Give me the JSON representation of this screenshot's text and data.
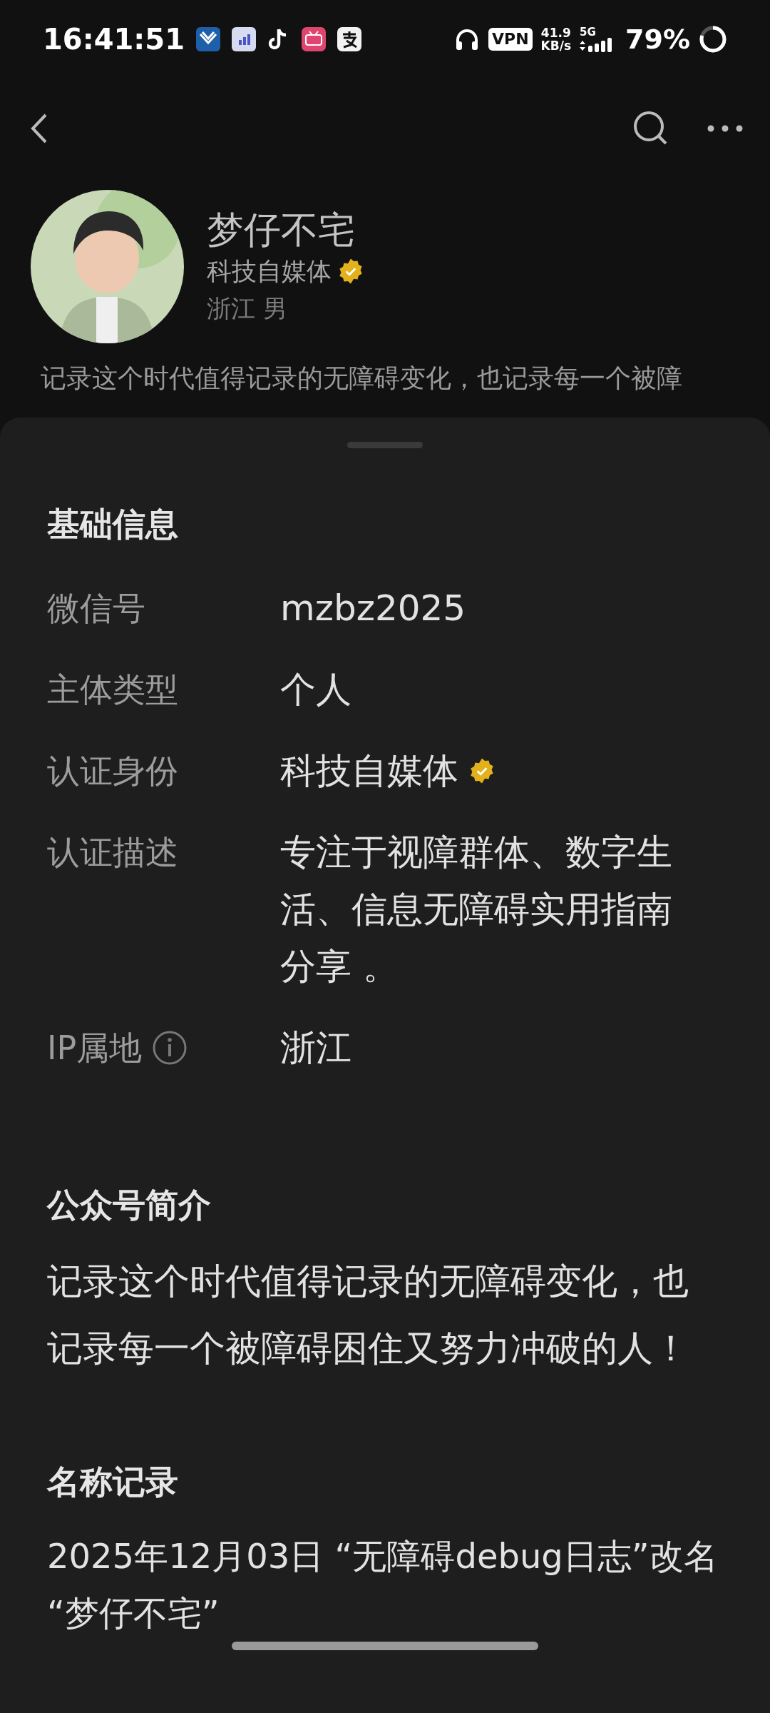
{
  "status_bar": {
    "time": "16:41:51",
    "vpn": "VPN",
    "speed": "41.9",
    "speed_unit": "KB/s",
    "network": "5G",
    "battery": "79%"
  },
  "profile": {
    "name": "梦仔不宅",
    "verification": "科技自媒体",
    "verified": true,
    "location_gender": "浙江 男",
    "bio": "记录这个时代值得记录的无障碍变化，也记录每一个被障"
  },
  "basic_info": {
    "title": "基础信息",
    "rows": [
      {
        "label": "微信号",
        "value": "mzbz2025",
        "verified": false,
        "info": false
      },
      {
        "label": "主体类型",
        "value": "个人",
        "verified": false,
        "info": false
      },
      {
        "label": "认证身份",
        "value": "科技自媒体",
        "verified": true,
        "info": false
      },
      {
        "label": "认证描述",
        "value": "专注于视障群体、数字生活、信息无障碍实用指南分享 。",
        "verified": false,
        "info": false
      },
      {
        "label": "IP属地",
        "value": "浙江",
        "verified": false,
        "info": true
      }
    ]
  },
  "intro": {
    "title": "公众号简介",
    "text": "记录这个时代值得记录的无障碍变化，也记录每一个被障碍困住又努力冲破的人！"
  },
  "name_history": {
    "title": "名称记录",
    "text": "2025年12月03日 “无障碍debug日志”改名 “梦仔不宅”"
  }
}
